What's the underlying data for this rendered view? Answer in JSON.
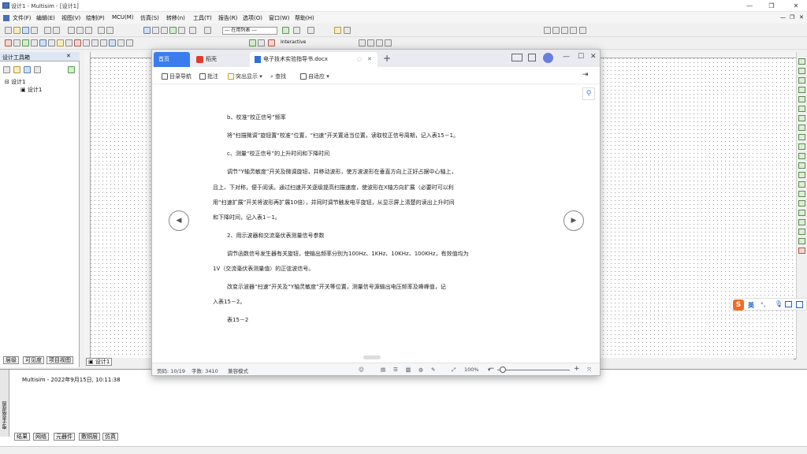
{
  "multisim": {
    "title": "设计1 - Multisim - [设计1]",
    "menu": [
      "文件(F)",
      "编辑(E)",
      "视图(V)",
      "绘制(P)",
      "MCU(M)",
      "仿真(S)",
      "转移(n)",
      "工具(T)",
      "报告(R)",
      "选项(O)",
      "窗口(W)",
      "帮助(H)"
    ],
    "toolbar": {
      "in_use_list": "--- 在用列表 ---",
      "interactive": "Interactive"
    },
    "left_panel": {
      "title": "设计工具箱",
      "tree_root": "设计1",
      "tree_child": "设计1",
      "tabs": [
        "层级",
        "可见度",
        "项目视图"
      ]
    },
    "doc_tab": "设计1",
    "output": {
      "side_label": "电子表格视图",
      "message": "Multisim  -  2022年9月15日, 10:11:38",
      "tabs": [
        "结果",
        "网络",
        "元器件",
        "敷铜层",
        "仿真"
      ]
    }
  },
  "wps": {
    "tabs": {
      "home": "首页",
      "pdf": "稻壳",
      "doc": "电子技术实验指导书.docx"
    },
    "toolbar": [
      "目录导航",
      "批注",
      "突出显示",
      "查找",
      "自适应"
    ],
    "content": [
      "b、校准“校正信号”频率",
      "将“扫描微调”旋钮置“校准”位置，“扫速”开关置适当位置，读取校正信号周期，记入表15－1。",
      "c、测量“校正信号”的上升时间和下降时间",
      "调节“Y轴灵敏度”开关及微调旋钮，并移动波形，使方波波形在垂直方向上正好占据中心轴上，",
      "且上、下对称，便于阅读。通过扫速开关逐级提高扫描速度，使波形在X轴方向扩展（必要时可以利",
      "用“扫速扩展”开关将波形再扩展10倍），并同时调节触发电平旋钮，从显示屏上清楚的读出上升时间",
      "和下降时间，记入表1－1。",
      "2、用示波器和交流毫伏表测量信号参数",
      "调节函数信号发生器有关旋钮，使输出频率分别为100Hz、1KHz、10KHz、100KHz，有效值均为",
      "1V（交流毫伏表测量值）的正弦波信号。",
      "改变示波器“扫速”开关及“Y轴灵敏度”开关等位置，测量信号源输出电压频率及峰峰值，记",
      "入表15－2。",
      "表15－2"
    ],
    "status": {
      "page": "页码: 10/19",
      "words": "字数: 3410",
      "mode": "兼容模式",
      "zoom": "100%"
    }
  },
  "ime": {
    "lang": "英",
    "symbols": "°，"
  },
  "colors": {
    "wps_accent": "#3b7ded",
    "ime_accent": "#f26a21"
  }
}
